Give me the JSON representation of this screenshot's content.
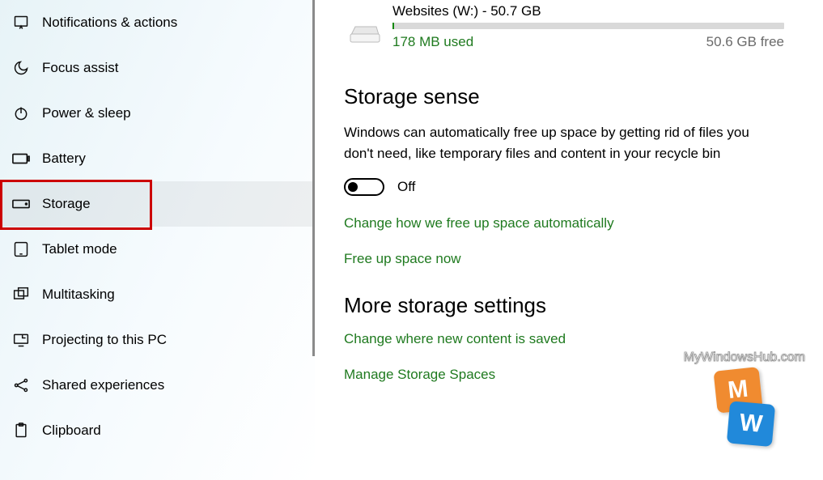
{
  "sidebar": {
    "items": [
      {
        "label": "Notifications & actions",
        "icon": "notifications-icon"
      },
      {
        "label": "Focus assist",
        "icon": "moon-icon"
      },
      {
        "label": "Power & sleep",
        "icon": "power-icon"
      },
      {
        "label": "Battery",
        "icon": "battery-icon"
      },
      {
        "label": "Storage",
        "icon": "storage-icon",
        "selected": true,
        "highlighted": true
      },
      {
        "label": "Tablet mode",
        "icon": "tablet-icon"
      },
      {
        "label": "Multitasking",
        "icon": "multitasking-icon"
      },
      {
        "label": "Projecting to this PC",
        "icon": "project-icon"
      },
      {
        "label": "Shared experiences",
        "icon": "share-icon"
      },
      {
        "label": "Clipboard",
        "icon": "clipboard-icon"
      }
    ]
  },
  "main": {
    "drive": {
      "title": "Websites (W:) - 50.7 GB",
      "used": "178 MB used",
      "free": "50.6 GB free"
    },
    "storage_sense": {
      "heading": "Storage sense",
      "description": "Windows can automatically free up space by getting rid of files you don't need, like temporary files and content in your recycle bin",
      "toggle_state": "Off",
      "link_change": "Change how we free up space automatically",
      "link_freeup": "Free up space now"
    },
    "more": {
      "heading": "More storage settings",
      "link_where": "Change where new content is saved",
      "link_spaces": "Manage Storage Spaces"
    }
  },
  "watermark": {
    "text": "MyWindowsHub.com",
    "letter1": "M",
    "letter2": "W"
  }
}
